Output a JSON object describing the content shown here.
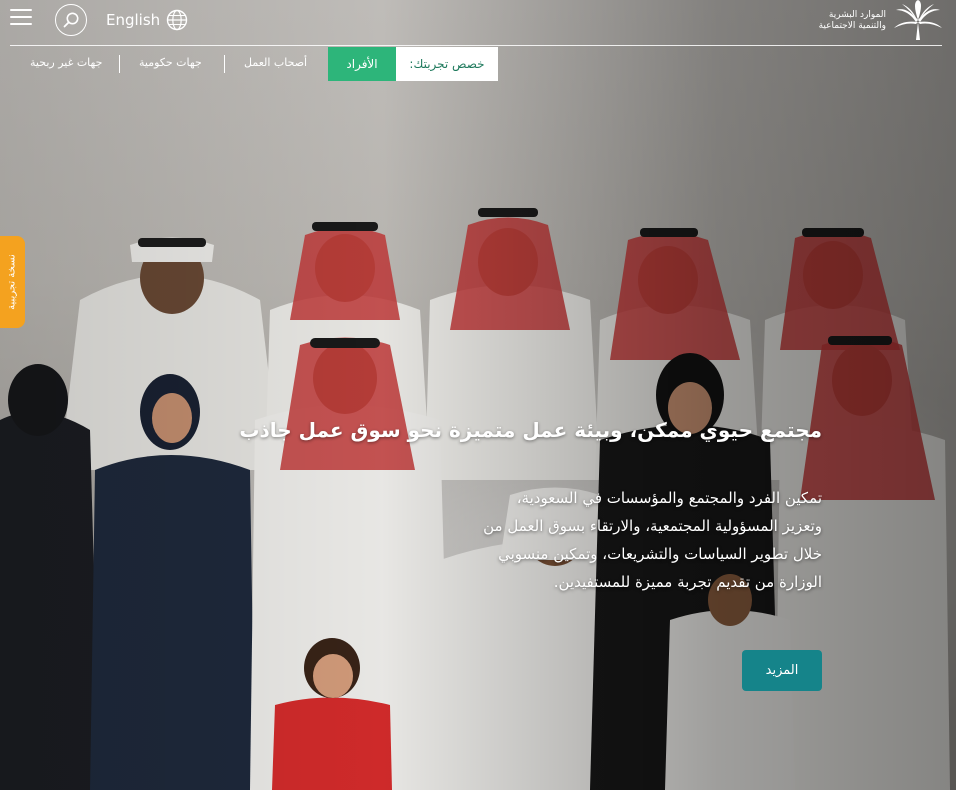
{
  "header": {
    "language_label": "English",
    "logo_line1": "الموارد البشرية",
    "logo_line2": "والتنمية الاجتماعية"
  },
  "segments": {
    "label": "خصص تجربتك:",
    "items": [
      {
        "label": "الأفراد",
        "active": true
      },
      {
        "label": "أصحاب العمل"
      },
      {
        "label": "جهات حكومية"
      },
      {
        "label": "جهات غير ربحية"
      }
    ]
  },
  "side_tab": {
    "label": "نسخة تجريبية"
  },
  "hero": {
    "headline": "مجتمع حيوي ممكن، وبيئة عمل متميزة نحو سوق عمل جاذب",
    "description": "تمكين الفرد والمجتمع والمؤسسات في السعودية، وتعزيز المسؤولية المجتمعية، والارتقاء بسوق العمل من خلال تطوير السياسات والتشريعات، وتمكين منسوبي الوزارة من تقديم تجربة مميزة للمستفيدين.",
    "more_label": "المزيد"
  },
  "colors": {
    "accent_green": "#2db57a",
    "button_teal": "#15848a",
    "side_tab_orange": "#f4a21f"
  }
}
